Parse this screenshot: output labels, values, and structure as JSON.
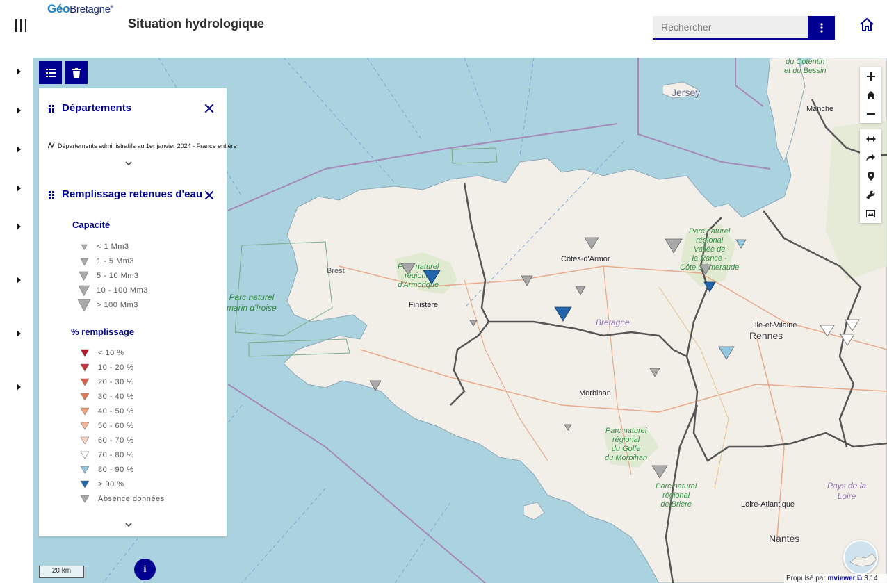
{
  "header": {
    "logo_geo": "Géo",
    "logo_bretagne": "Bretagne",
    "logo_reg": "®",
    "title": "Situation hydrologique",
    "search_placeholder": "Rechercher"
  },
  "map": {
    "places": {
      "jersey": "Jersey",
      "manche": "Manche",
      "cotes_armor": "Côtes-d'Armor",
      "brest": "Brest",
      "finistere": "Finistère",
      "bretagne": "Bretagne",
      "ille_vilaine": "Ille-et-Vilaine",
      "rennes": "Rennes",
      "morbihan": "Morbihan",
      "loire_atlantique": "Loire-Atlantique",
      "nantes": "Nantes"
    },
    "parks": {
      "armorique": "Parc naturel\nrégional\nd'Armorique",
      "iroise": "Parc naturel\nmarin d'Iroise",
      "rance": "Parc naturel\nrégional\nVallée de\nla Rance -\nCôte d'Émeraude",
      "golfe": "Parc naturel\nrégional\ndu Golfe\ndu Morbihan",
      "briere": "Parc naturel\nrégional\nde Brière",
      "cotentin": "du Cotentin\net du Bessin"
    },
    "regions": {
      "pays_loire": "Pays de la\nLoire"
    },
    "scale_label": "20 km",
    "info_label": "i",
    "attribution_prefix": "Propulsé par",
    "attribution_link": "mviewer",
    "attribution_version": "3.14"
  },
  "legend": {
    "departements": {
      "title": "Départements",
      "layer": "Départements administratifs au 1er janvier 2024 - France entière"
    },
    "retenues": {
      "title": "Remplissage retenues d'eau",
      "capacite_title": "Capacité",
      "capacite": [
        {
          "label": "< 1 Mm3",
          "size": 1
        },
        {
          "label": "1 - 5 Mm3",
          "size": 2
        },
        {
          "label": "5 - 10 Mm3",
          "size": 3
        },
        {
          "label": "10 - 100 Mm3",
          "size": 4
        },
        {
          "label": "> 100 Mm3",
          "size": 5
        }
      ],
      "remplissage_title": "% remplissage",
      "remplissage": [
        {
          "label": "< 10 %",
          "color": "#b2182b"
        },
        {
          "label": "10 - 20 %",
          "color": "#c6323d"
        },
        {
          "label": "20 - 30 %",
          "color": "#d6604d"
        },
        {
          "label": "30 - 40 %",
          "color": "#e07b5a"
        },
        {
          "label": "40 - 50 %",
          "color": "#f0a27a"
        },
        {
          "label": "50 - 60 %",
          "color": "#f4b597"
        },
        {
          "label": "60 - 70 %",
          "color": "#fbd5c5"
        },
        {
          "label": "70 - 80 %",
          "color": "#ffffff"
        },
        {
          "label": "80 - 90 %",
          "color": "#92c5de"
        },
        {
          "label": "> 90 %",
          "color": "#2166ac"
        },
        {
          "label": "Absence données",
          "color": "#a9a9a9"
        }
      ]
    }
  },
  "colors": {
    "accent": "#000091",
    "sea": "#aad3df",
    "land": "#f2efe9",
    "dept_border": "#555555"
  }
}
